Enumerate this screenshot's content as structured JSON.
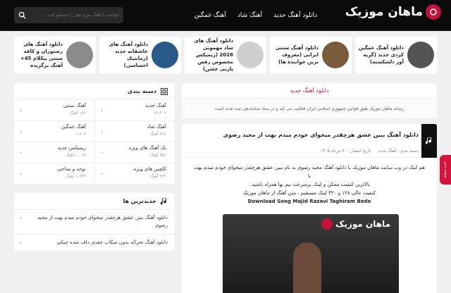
{
  "header": {
    "logo_text": "ماهان موزیک",
    "nav": [
      "دانلود آهنگ جدید",
      "آهنگ شاد",
      "آهنگ غمگین"
    ],
    "search_placeholder": "خواننده یا آهنگ مورد نظر را جستجو کنید ..."
  },
  "strip": [
    {
      "title": "دانلود آهنگ غمگین کردی جدید (گریه آور دلشکسته)",
      "color": "#555"
    },
    {
      "title": "دانلود آهنگ سنتی ایرانی (معروف ترین خواننده ها)",
      "color": "#7a5a3a"
    },
    {
      "title": "دانلود آهنگ های شاد مهمونی 2026 (ریمیکس مخصوص رقص پارتی جشن)",
      "color": "#cfcfcf"
    },
    {
      "title": "دانلود آهنگ های عاشقانه جدید (رمانتیک احساسی)",
      "color": "#2a5a8a"
    },
    {
      "title": "دانلود آهنگ های رستوران و کافه سنتی بیکلام 45+ آهنگ برگزیده",
      "color": "#8a8a8a"
    }
  ],
  "main": {
    "section_title": "دانلود آهنگ جدید",
    "notice": "رسانه ماهان موزیک طبق قوانین جمهوری اسلامی ایران فعالیت می کند و در ستاد ساماندهی ثبت شده است",
    "post": {
      "title": "دانلود آهنگ ببین عشق هرچقدر میخوای خودم میدم بهت از مجید رضوی",
      "category": "دسته بندی : آهنگ جدید",
      "date": "تاریخ انتشار : ۳۰ مرداد ۱۴۰۵",
      "lines": [
        "هم اینک در وب سایت ماهان موزیک با دانلود آهنگ مجید رضوی به نام ببین عشق هرچقدر میخوای خودم میدم بهت با",
        "بالاترین کیفیت ممکن و لینک پرسرعت نیم بها همراه باشید..",
        "کیفیت عالی ۱۲۸ و ۳۲۰ لینک مستقیم ، متن آهنگ از ماهان موزیک"
      ],
      "english": "Download Song Majid Razavi Taghiram Bede",
      "watermark": "ماهان موزیک"
    }
  },
  "side": {
    "categories_title": "دسته بندی",
    "categories": [
      {
        "name": "آهنگ جدید",
        "count": "۲۳,۲۰۷"
      },
      {
        "name": "آهنگ سنتی",
        "count": "۱۷۶ آهنگ"
      },
      {
        "name": "آهنگ شاد",
        "count": "۸۹۱ آهنگ"
      },
      {
        "name": "آهنگ غمگین",
        "count": "۱,۸۰۳"
      },
      {
        "name": "تک آهنگ های ویژه",
        "count": "۹۵۶ آهنگ"
      },
      {
        "name": "ریمیکس جدید",
        "count": "۱,۰۸۹ آهنگ"
      },
      {
        "name": "کلچین های ویژه",
        "count": "۲۳۶ آهنگ"
      },
      {
        "name": "نوحه و مداحی",
        "count": "۱,۶۴۳ آهنگ"
      }
    ],
    "latest_title": "جدیدترین ها",
    "latest": [
      "دانلود آهنگ ببین عشق هرچقدر میخوای خودم میدم بهت از مجید رضوی",
      "دانلود آهنگ تجراله بدون میکاپ چقدی داف شده چیکی"
    ]
  },
  "floating_tab": "صفحه بندی"
}
